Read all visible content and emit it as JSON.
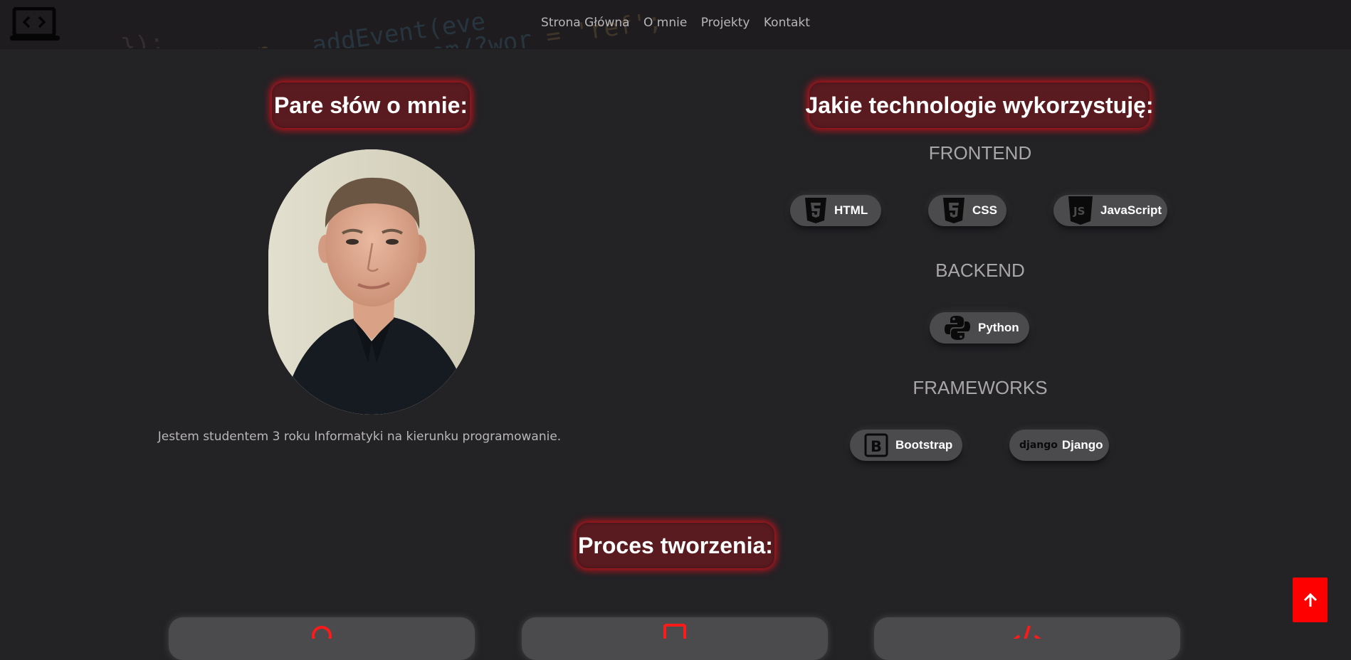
{
  "nav": {
    "links": [
      "Strona Główna",
      "O mnie",
      "Projekty",
      "Kontakt"
    ]
  },
  "about": {
    "title": "Pare słów o mnie:",
    "text": "Jestem studentem 3 roku Informatyki na kierunku programowanie."
  },
  "tech": {
    "title": "Jakie technologie wykorzystuję:",
    "frontend_title": "FRONTEND",
    "frontend": [
      "HTML",
      "CSS",
      "JavaScript"
    ],
    "backend_title": "BACKEND",
    "backend": [
      "Python"
    ],
    "frameworks_title": "FRAMEWORKS",
    "frameworks": [
      "Bootstrap",
      "Django"
    ],
    "django_logo": "django"
  },
  "process": {
    "title": "Proces tworzenia:"
  },
  "colors": {
    "background": "#232225",
    "accent": "#ff0000",
    "title_pill": "#5a1b20",
    "chip": "#4b4a4d"
  },
  "icons": [
    "laptop-code-icon",
    "html5-icon",
    "css3-icon",
    "js-icon",
    "python-icon",
    "bootstrap-icon",
    "django-icon",
    "arrow-up-icon"
  ]
}
